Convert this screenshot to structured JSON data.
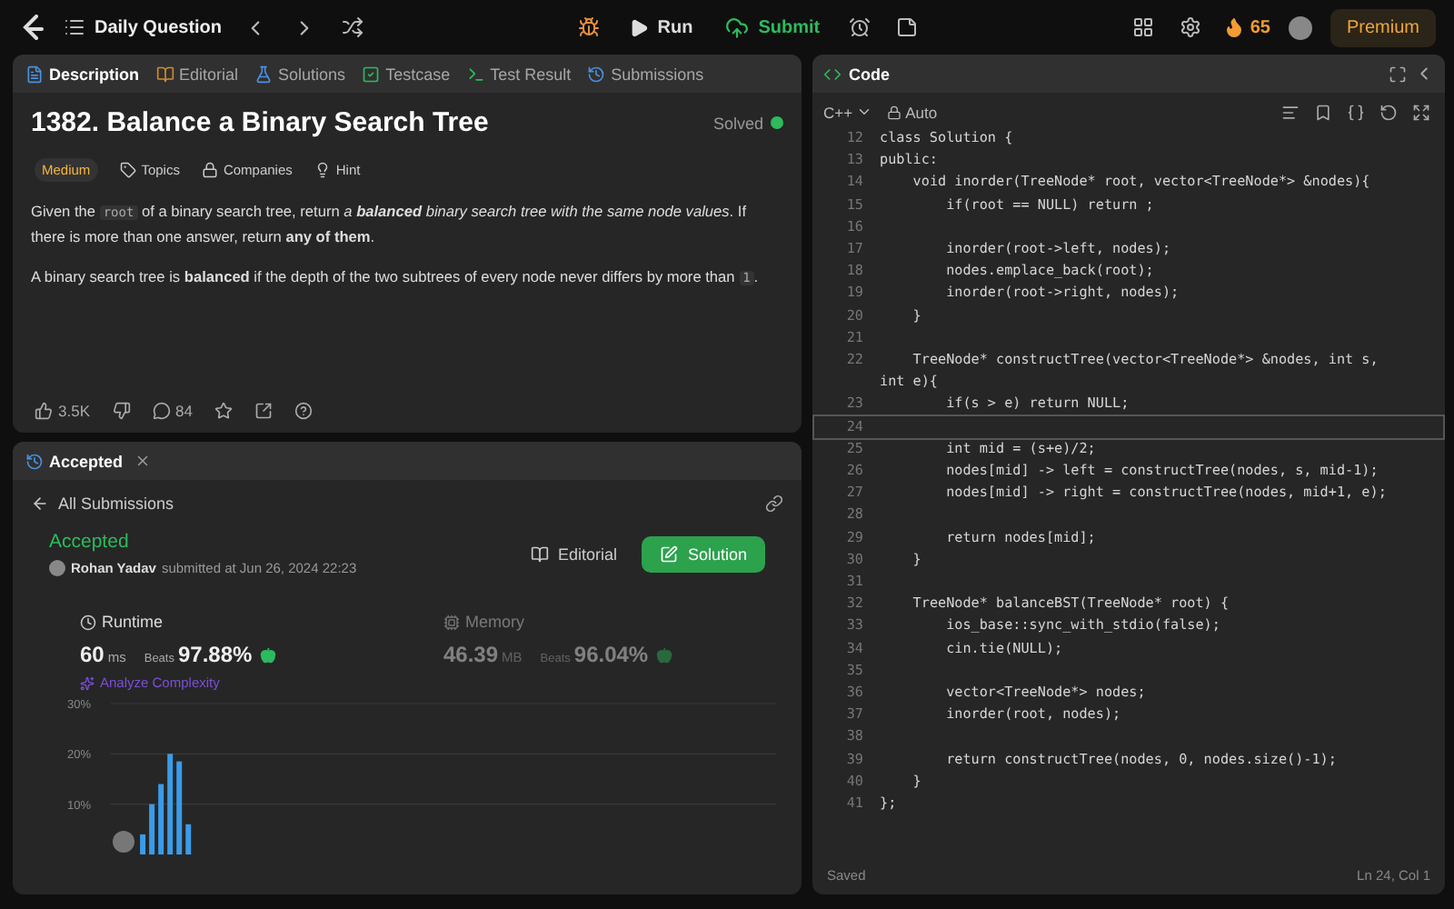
{
  "topbar": {
    "title": "Daily Question",
    "run": "Run",
    "submit": "Submit",
    "streak": "65",
    "premium": "Premium"
  },
  "tabs": [
    {
      "label": "Description",
      "selected": true,
      "color": "#4a90e2"
    },
    {
      "label": "Editorial",
      "selected": false,
      "color": "#d08c2c"
    },
    {
      "label": "Solutions",
      "selected": false,
      "color": "#4a90e2"
    },
    {
      "label": "Testcase",
      "selected": false,
      "color": "#2cbb5d"
    },
    {
      "label": "Test Result",
      "selected": false,
      "color": "#2cbb5d"
    },
    {
      "label": "Submissions",
      "selected": false,
      "color": "#4a90e2"
    }
  ],
  "problem": {
    "title": "1382. Balance a Binary Search Tree",
    "status": "Solved",
    "solved": true,
    "difficulty": "Medium",
    "meta": [
      "Topics",
      "Companies",
      "Hint"
    ],
    "paragraphs": [
      [
        {
          "kind": "text",
          "text": "Given the "
        },
        {
          "kind": "code",
          "text": "root"
        },
        {
          "kind": "text",
          "text": " of a binary search tree, return "
        },
        {
          "kind": "italic",
          "text": "a "
        },
        {
          "kind": "bold_italic",
          "text": "balanced"
        },
        {
          "kind": "italic",
          "text": " binary search tree with the same node values"
        },
        {
          "kind": "text",
          "text": ". If there is more than one answer, return "
        },
        {
          "kind": "bold",
          "text": "any of them"
        },
        {
          "kind": "text",
          "text": "."
        }
      ],
      [
        {
          "kind": "text",
          "text": "A binary search tree is "
        },
        {
          "kind": "bold",
          "text": "balanced"
        },
        {
          "kind": "text",
          "text": " if the depth of the two subtrees of every node never differs by more than "
        },
        {
          "kind": "code",
          "text": "1"
        },
        {
          "kind": "text",
          "text": "."
        }
      ]
    ],
    "likes": "3.5K",
    "comments": "84"
  },
  "result": {
    "tab": "Accepted",
    "back": "All Submissions",
    "status": "Accepted",
    "author": "Rohan Yadav",
    "submitted": "submitted at Jun 26, 2024 22:23",
    "editorial": "Editorial",
    "solution": "Solution",
    "stats": [
      {
        "label": "Runtime",
        "value": "60",
        "unit": "ms",
        "beats_label": "Beats",
        "beats": "97.88%",
        "selected": true
      },
      {
        "label": "Memory",
        "value": "46.39",
        "unit": "MB",
        "beats_label": "Beats",
        "beats": "96.04%",
        "selected": false
      }
    ],
    "analyze": "Analyze Complexity",
    "chart_data": {
      "type": "bar",
      "grid": true,
      "values": [
        null,
        null,
        null,
        4,
        10,
        14,
        20,
        18.5,
        6,
        null,
        null,
        null,
        null,
        null,
        null,
        null,
        null,
        null,
        null,
        null,
        null,
        null,
        null,
        null,
        null,
        null,
        null,
        null,
        null,
        null,
        null,
        null,
        null,
        null,
        null,
        null,
        null,
        null,
        null,
        null,
        null,
        null,
        null,
        null,
        null,
        null,
        null,
        null,
        null,
        null,
        null,
        null,
        null,
        null,
        null,
        null,
        null,
        null,
        null,
        null,
        null,
        null,
        null,
        null,
        null,
        null,
        null,
        null,
        null,
        null,
        null,
        null,
        null
      ],
      "ylim": [
        0,
        30
      ],
      "yticks": [
        {
          "value": 10,
          "label": "10%"
        },
        {
          "value": 20,
          "label": "20%"
        },
        {
          "value": 30,
          "label": "30%"
        }
      ]
    }
  },
  "editor": {
    "title": "Code",
    "language": "C++",
    "mode": "Auto",
    "status": "Saved",
    "position": "Ln 24, Col 1",
    "lines": [
      {
        "number": "12",
        "text": "class Solution {",
        "current": false
      },
      {
        "number": "13",
        "text": "public:",
        "current": false
      },
      {
        "number": "14",
        "text": "    void inorder(TreeNode* root, vector<TreeNode*> &nodes){",
        "current": false
      },
      {
        "number": "15",
        "text": "        if(root == NULL) return ;",
        "current": false
      },
      {
        "number": "16",
        "current": false
      },
      {
        "number": "17",
        "text": "        inorder(root->left, nodes);",
        "current": false
      },
      {
        "number": "18",
        "text": "        nodes.emplace_back(root);",
        "current": false
      },
      {
        "number": "19",
        "text": "        inorder(root->right, nodes);",
        "current": false
      },
      {
        "number": "20",
        "text": "    }",
        "current": false
      },
      {
        "number": "21",
        "current": false
      },
      {
        "number": "22",
        "text": "    TreeNode* constructTree(vector<TreeNode*> &nodes, int s, int e){",
        "current": false
      },
      {
        "number": "23",
        "text": "        if(s > e) return NULL;",
        "current": false
      },
      {
        "number": "24",
        "current": true
      },
      {
        "number": "25",
        "text": "        int mid = (s+e)/2;",
        "current": false
      },
      {
        "number": "26",
        "text": "        nodes[mid] -> left = constructTree(nodes, s, mid-1);",
        "current": false
      },
      {
        "number": "27",
        "text": "        nodes[mid] -> right = constructTree(nodes, mid+1, e);",
        "current": false
      },
      {
        "number": "28",
        "current": false
      },
      {
        "number": "29",
        "text": "        return nodes[mid];",
        "current": false
      },
      {
        "number": "30",
        "text": "    }",
        "current": false
      },
      {
        "number": "31",
        "current": false
      },
      {
        "number": "32",
        "text": "    TreeNode* balanceBST(TreeNode* root) {",
        "current": false
      },
      {
        "number": "33",
        "text": "        ios_base::sync_with_stdio(false);",
        "current": false
      },
      {
        "number": "34",
        "text": "        cin.tie(NULL);",
        "current": false
      },
      {
        "number": "35",
        "current": false
      },
      {
        "number": "36",
        "text": "        vector<TreeNode*> nodes;",
        "current": false
      },
      {
        "number": "37",
        "text": "        inorder(root, nodes);",
        "current": false
      },
      {
        "number": "38",
        "current": false
      },
      {
        "number": "39",
        "text": "        return constructTree(nodes, 0, nodes.size()-1);",
        "current": false
      },
      {
        "number": "40",
        "text": "    }",
        "current": false
      },
      {
        "number": "41",
        "text": "};",
        "current": false
      }
    ]
  }
}
